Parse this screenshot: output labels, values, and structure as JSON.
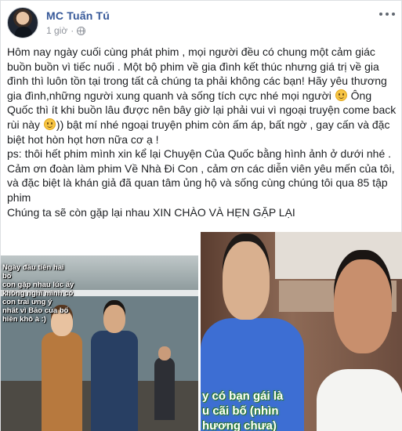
{
  "post": {
    "author": "MC Tuấn Tú",
    "timestamp": "1 giờ",
    "privacy_icon": "globe-icon",
    "more_icon": "more-options-icon",
    "paragraphs": [
      {
        "before": "Hôm nay ngày cuối cùng phát phim , mọi người đều có chung một cảm giác buồn buồn vì tiếc nuối . Một bộ phim về gia đình kết thúc nhưng giá trị về gia đình thì luôn tồn tại trong tất cả chúng ta phải không các bạn! Hãy yêu thương gia đình,những người xung quanh và sống tích cực nhé mọi người ",
        "middle": " Ông Quốc thì ít khi buồn lâu được nên bây giờ lại phải vui vì ngoại truyện come back rùi này ",
        "after": ")) bật mí nhé ngoại truyện phim còn ấm áp, bất ngờ , gay cấn và đặc biệt hot hòn họt hơn nữa cơ ạ !"
      },
      "ps: thôi hết phim mình xin kể lại Chuyện Của Quốc bằng hình ảnh ở dưới nhé . Cảm ơn đoàn làm phim Về Nhà Đi Con , cảm ơn các diễn viên yêu mến của tôi, và đặc biệt là khán giả đã quan tâm ủng hộ và sống cùng chúng tôi qua 85 tập phim",
      "Chúng ta sẽ còn gặp lại nhau XIN CHÀO VÀ HẸN GẶP LẠI"
    ],
    "emoji_name": "smiley-emoji-icon"
  },
  "photos": {
    "left_caption": "Ngày đầu tiên hai bố\ncon gặp nhau lúc ấy\nkhông nghĩ mình có\ncon trai ưng ý\nnhất vì Bảo của bố\nhiền khô à :)",
    "right_caption": "y có bạn gái là\nu cãi bố (nhìn\nhương chưa)"
  }
}
